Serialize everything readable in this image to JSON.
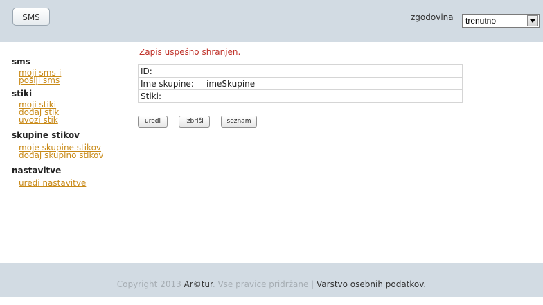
{
  "header": {
    "sms_button": "SMS",
    "history_label": "zgodovina",
    "history_select_value": "trenutno"
  },
  "sidebar": {
    "sections": [
      {
        "title": "sms",
        "links": [
          "moji sms-i",
          "pošlji sms"
        ]
      },
      {
        "title": "stiki",
        "links": [
          "moji stiki",
          "dodaj stik",
          "uvozi stik"
        ]
      },
      {
        "title": "skupine stikov",
        "links": [
          "moje skupine stikov",
          "dodaj skupino stikov"
        ]
      },
      {
        "title": "nastavitve",
        "links": [
          "uredi nastavitve"
        ]
      }
    ]
  },
  "main": {
    "message": "Zapis uspešno shranjen.",
    "rows": [
      {
        "label": "ID:",
        "value": ""
      },
      {
        "label": "Ime skupine:",
        "value": "imeSkupine"
      },
      {
        "label": "Stiki:",
        "value": ""
      }
    ],
    "buttons": {
      "edit": "uredi",
      "delete": "izbriši",
      "list": "seznam"
    }
  },
  "footer": {
    "copyright": "Copyright 2013 ",
    "brand": "Ar©tur",
    "rights": ". Vse pravice pridržane | ",
    "privacy": "Varstvo osebnih podatkov",
    "end": "."
  },
  "colors": {
    "header_bg": "#d2dbe3",
    "link": "#c98a18",
    "success_message": "#c0332b"
  }
}
